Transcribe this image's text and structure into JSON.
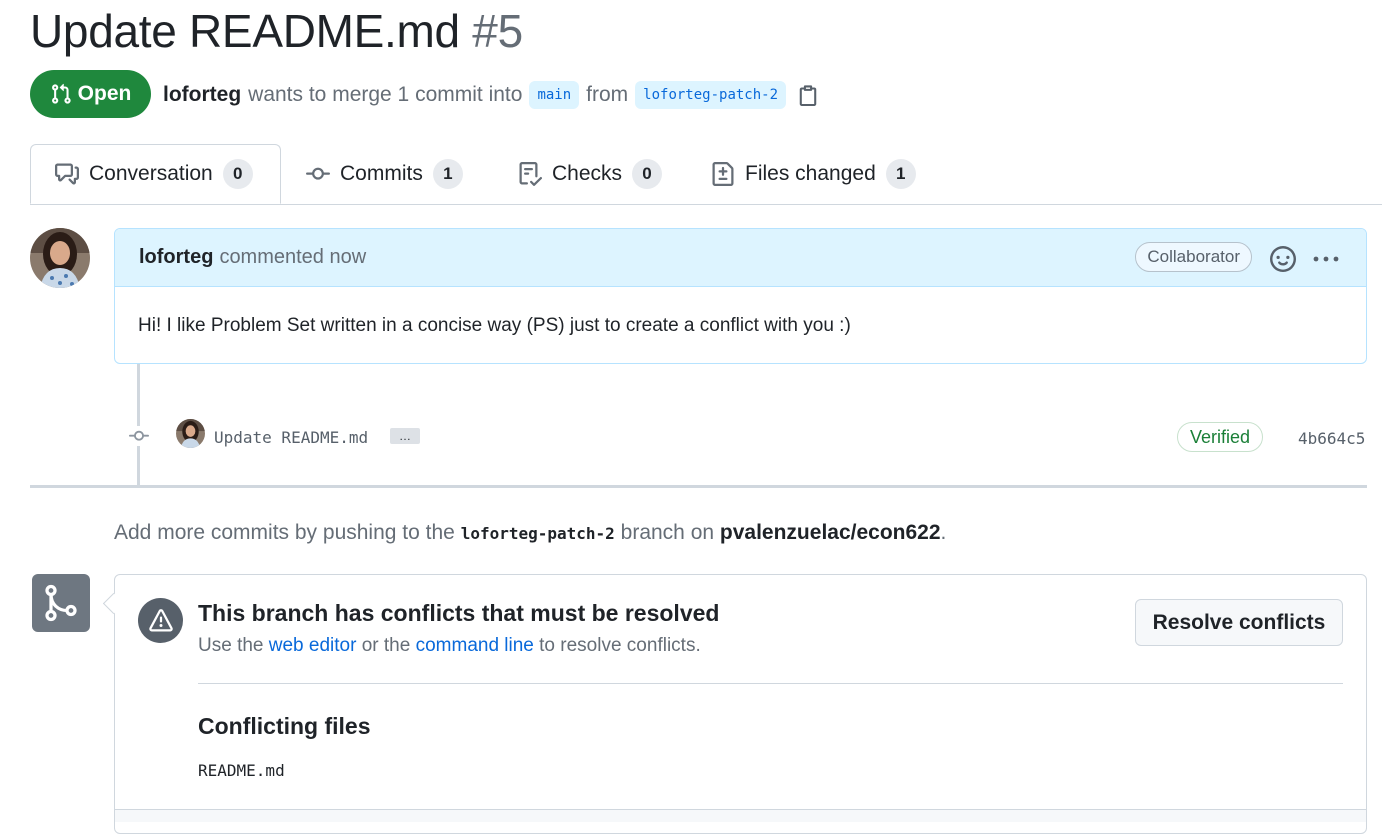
{
  "pr": {
    "title": "Update README.md",
    "number": "#5",
    "state": "Open",
    "author": "loforteg",
    "merge_text": "wants to merge 1 commit into",
    "base_branch": "main",
    "from_text": "from",
    "head_branch": "loforteg-patch-2"
  },
  "tabs": [
    {
      "label": "Conversation",
      "count": "0",
      "icon": "comment-discussion-icon"
    },
    {
      "label": "Commits",
      "count": "1",
      "icon": "git-commit-icon"
    },
    {
      "label": "Checks",
      "count": "0",
      "icon": "checklist-icon"
    },
    {
      "label": "Files changed",
      "count": "1",
      "icon": "file-diff-icon"
    }
  ],
  "comment": {
    "author": "loforteg",
    "time": "commented now",
    "role": "Collaborator",
    "body": "Hi! I like Problem Set written in a concise way (PS) just to create a conflict with you :)"
  },
  "commit": {
    "message": "Update README.md",
    "ellipsis": "…",
    "verified": "Verified",
    "sha": "4b664c5"
  },
  "push_hint": {
    "prefix": "Add more commits by pushing to the",
    "branch": "loforteg-patch-2",
    "middle": "branch on",
    "repo": "pvalenzuelac/econ622",
    "suffix": "."
  },
  "merge": {
    "title": "This branch has conflicts that must be resolved",
    "desc_prefix": "Use the",
    "web_editor": "web editor",
    "desc_middle": "or the",
    "command_line": "command line",
    "desc_suffix": "to resolve conflicts.",
    "button": "Resolve conflicts",
    "conflicting_title": "Conflicting files",
    "files": [
      "README.md"
    ]
  },
  "colors": {
    "open_green": "#1f883d",
    "link_blue": "#0969da",
    "comment_header_bg": "#ddf4ff",
    "verified_green": "#1a7f37"
  }
}
